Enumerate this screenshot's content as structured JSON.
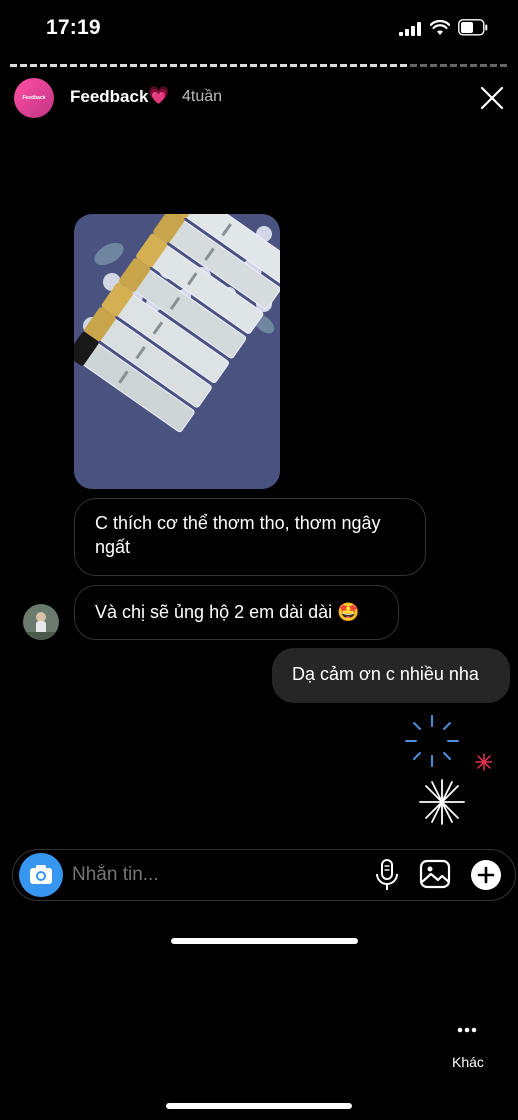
{
  "status_bar": {
    "time": "17:19"
  },
  "header": {
    "avatar_text": "Feedback",
    "username": "Feedback",
    "heart": "💗",
    "age": "4tuần"
  },
  "messages": [
    {
      "side": "left",
      "text": "C thích cơ thể thơm tho, thơm ngây ngất"
    },
    {
      "side": "left",
      "text": "Và chị sẽ ủng hộ 2 em dài dài 🤩"
    },
    {
      "side": "right",
      "text": "Dạ cảm ơn c nhiều nha"
    }
  ],
  "composer": {
    "placeholder": "Nhắn tin..."
  },
  "more": {
    "label": "Khác"
  },
  "colors": {
    "accent": "#3797f0",
    "bubble_right": "#262626",
    "story_ring": "#c13584"
  }
}
